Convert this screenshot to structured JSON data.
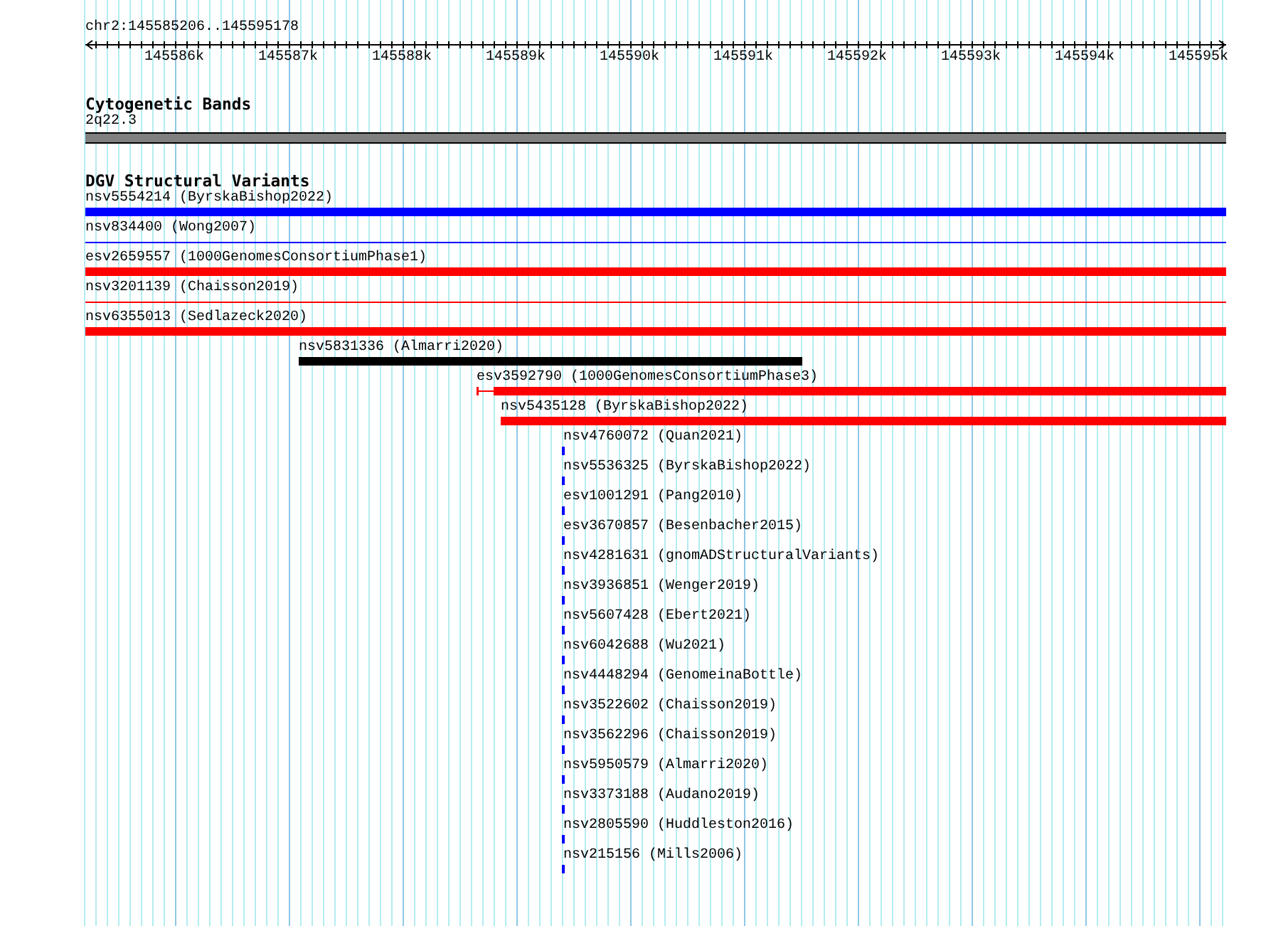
{
  "ruler": {
    "region": "chr2:145585206..145595178",
    "tick_labels": [
      "145586k",
      "145587k",
      "145588k",
      "145589k",
      "145590k",
      "145591k",
      "145592k",
      "145593k",
      "145594k",
      "145595k"
    ]
  },
  "cytogenetic_track": {
    "title": "Cytogenetic Bands",
    "band": "2q22.3"
  },
  "variant_track": {
    "title": "DGV Structural Variants",
    "features": [
      {
        "label": "nsv5554214 (ByrskaBishop2022)",
        "kind": "bar",
        "color": "#0000ff"
      },
      {
        "label": "nsv834400 (Wong2007)",
        "kind": "line",
        "color": "#0000ff"
      },
      {
        "label": "esv2659557 (1000GenomesConsortiumPhase1)",
        "kind": "bar",
        "color": "#ff0000"
      },
      {
        "label": "nsv3201139 (Chaisson2019)",
        "kind": "line",
        "color": "#ff0000"
      },
      {
        "label": "nsv6355013 (Sedlazeck2020)",
        "kind": "bar",
        "color": "#ff0000"
      },
      {
        "label": "nsv5831336 (Almarri2020)",
        "kind": "bar",
        "color": "#000000"
      },
      {
        "label": "esv3592790 (1000GenomesConsortiumPhase3)",
        "kind": "split",
        "color": "#ff0000"
      },
      {
        "label": "nsv5435128 (ByrskaBishop2022)",
        "kind": "bar",
        "color": "#ff0000"
      },
      {
        "label": "nsv4760072 (Quan2021)",
        "kind": "bar",
        "color": "#0000ff"
      },
      {
        "label": "nsv5536325 (ByrskaBishop2022)",
        "kind": "bar",
        "color": "#0000ff"
      },
      {
        "label": "esv1001291 (Pang2010)",
        "kind": "bar",
        "color": "#0000ff"
      },
      {
        "label": "esv3670857 (Besenbacher2015)",
        "kind": "bar",
        "color": "#0000ff"
      },
      {
        "label": "nsv4281631 (gnomADStructuralVariants)",
        "kind": "bar",
        "color": "#0000ff"
      },
      {
        "label": "nsv3936851 (Wenger2019)",
        "kind": "bar",
        "color": "#0000ff"
      },
      {
        "label": "nsv5607428 (Ebert2021)",
        "kind": "bar",
        "color": "#0000ff"
      },
      {
        "label": "nsv6042688 (Wu2021)",
        "kind": "bar",
        "color": "#0000ff"
      },
      {
        "label": "nsv4448294 (GenomeinaBottle)",
        "kind": "bar",
        "color": "#0000ff"
      },
      {
        "label": "nsv3522602 (Chaisson2019)",
        "kind": "bar",
        "color": "#0000ff"
      },
      {
        "label": "nsv3562296 (Chaisson2019)",
        "kind": "bar",
        "color": "#0000ff"
      },
      {
        "label": "nsv5950579 (Almarri2020)",
        "kind": "bar",
        "color": "#0000ff"
      },
      {
        "label": "nsv3373188 (Audano2019)",
        "kind": "bar",
        "color": "#0000ff"
      },
      {
        "label": "nsv2805590 (Huddleston2016)",
        "kind": "bar",
        "color": "#0000ff"
      },
      {
        "label": "nsv215156 (Mills2006)",
        "kind": "bar",
        "color": "#0000ff"
      }
    ]
  }
}
